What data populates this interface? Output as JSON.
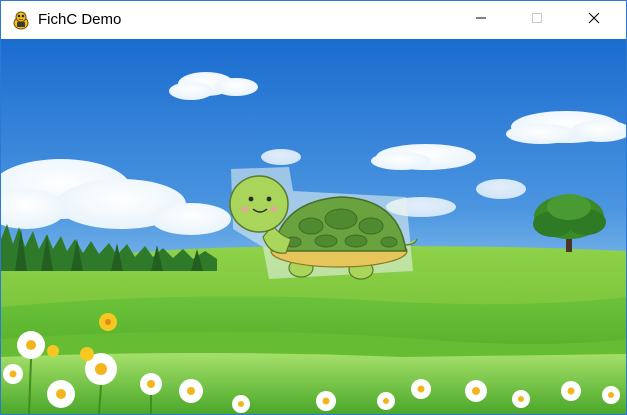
{
  "window": {
    "title": "FichC Demo",
    "icon": "pygame-snake-icon",
    "controls": {
      "minimize_icon": "minimize-icon",
      "maximize_icon": "maximize-icon",
      "close_icon": "close-icon"
    }
  },
  "scene": {
    "background": "sky-meadow-background",
    "sprite": "turtle-sprite",
    "colors": {
      "border": "#2b79d6",
      "sky_top": "#1d6fd1",
      "sky_bottom": "#9fd1f2",
      "grass": "#5fb526",
      "turtle_body": "#a9d65a",
      "turtle_shell": "#5f9a3a"
    }
  }
}
